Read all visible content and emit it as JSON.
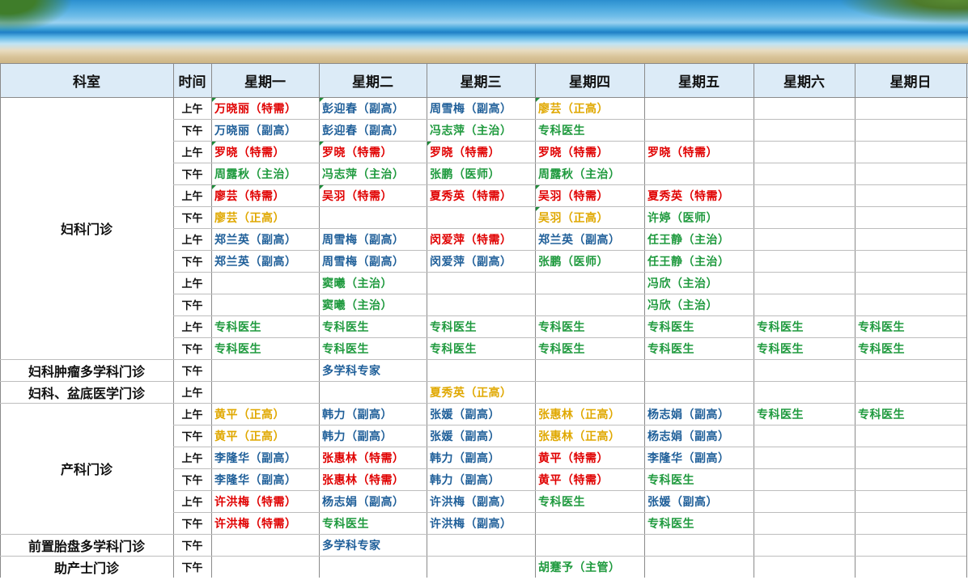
{
  "colors": {
    "red": "#e00000",
    "blue": "#1f5f99",
    "green": "#1f9a3e",
    "gold": "#e0a800",
    "header_bg": "#dcebf7"
  },
  "header": [
    "科室",
    "时间",
    "星期一",
    "星期二",
    "星期三",
    "星期四",
    "星期五",
    "星期六",
    "星期日"
  ],
  "departments": [
    {
      "name": "妇科门诊",
      "rows": [
        {
          "time": "上午",
          "cells": [
            [
              "万晓丽（特需）",
              "red"
            ],
            [
              "彭迎春（副高）",
              "blue"
            ],
            [
              "周雪梅（副高）",
              "blue"
            ],
            [
              "廖芸（正高）",
              "gold"
            ],
            null,
            null,
            null
          ]
        },
        {
          "time": "下午",
          "cells": [
            [
              "万晓丽（副高）",
              "blue"
            ],
            [
              "彭迎春（副高）",
              "blue"
            ],
            [
              "冯志萍（主治）",
              "green"
            ],
            [
              "专科医生",
              "green"
            ],
            null,
            null,
            null
          ]
        },
        {
          "time": "上午",
          "cells": [
            [
              "罗晓（特需）",
              "red"
            ],
            [
              "罗晓（特需）",
              "red"
            ],
            [
              "罗晓（特需）",
              "red"
            ],
            [
              "罗晓（特需）",
              "red"
            ],
            [
              "罗晓（特需）",
              "red"
            ],
            null,
            null
          ]
        },
        {
          "time": "下午",
          "cells": [
            [
              "周露秋（主治）",
              "green"
            ],
            [
              "冯志萍（主治）",
              "green"
            ],
            [
              "张鹏（医师）",
              "green"
            ],
            [
              "周露秋（主治）",
              "green"
            ],
            null,
            null,
            null
          ]
        },
        {
          "time": "上午",
          "cells": [
            [
              "廖芸（特需）",
              "red"
            ],
            [
              "吴羽（特需）",
              "red"
            ],
            [
              "夏秀英（特需）",
              "red"
            ],
            [
              "吴羽（特需）",
              "red"
            ],
            [
              "夏秀英（特需）",
              "red"
            ],
            null,
            null
          ]
        },
        {
          "time": "下午",
          "cells": [
            [
              "廖芸（正高）",
              "gold"
            ],
            null,
            null,
            [
              "吴羽（正高）",
              "gold"
            ],
            [
              "许婷（医师）",
              "green"
            ],
            null,
            null
          ]
        },
        {
          "time": "上午",
          "cells": [
            [
              "郑兰英（副高）",
              "blue"
            ],
            [
              "周雪梅（副高）",
              "blue"
            ],
            [
              "闵爱萍（特需）",
              "red"
            ],
            [
              "郑兰英（副高）",
              "blue"
            ],
            [
              "任王静（主治）",
              "green"
            ],
            null,
            null
          ]
        },
        {
          "time": "下午",
          "cells": [
            [
              "郑兰英（副高）",
              "blue"
            ],
            [
              "周雪梅（副高）",
              "blue"
            ],
            [
              "闵爱萍（副高）",
              "blue"
            ],
            [
              "张鹏（医师）",
              "green"
            ],
            [
              "任王静（主治）",
              "green"
            ],
            null,
            null
          ]
        },
        {
          "time": "上午",
          "cells": [
            null,
            [
              "窦曦（主治）",
              "green"
            ],
            null,
            null,
            [
              "冯欣（主治）",
              "green"
            ],
            null,
            null
          ]
        },
        {
          "time": "下午",
          "cells": [
            null,
            [
              "窦曦（主治）",
              "green"
            ],
            null,
            null,
            [
              "冯欣（主治）",
              "green"
            ],
            null,
            null
          ]
        },
        {
          "time": "上午",
          "cells": [
            [
              "专科医生",
              "green"
            ],
            [
              "专科医生",
              "green"
            ],
            [
              "专科医生",
              "green"
            ],
            [
              "专科医生",
              "green"
            ],
            [
              "专科医生",
              "green"
            ],
            [
              "专科医生",
              "green"
            ],
            [
              "专科医生",
              "green"
            ]
          ]
        },
        {
          "time": "下午",
          "cells": [
            [
              "专科医生",
              "green"
            ],
            [
              "专科医生",
              "green"
            ],
            [
              "专科医生",
              "green"
            ],
            [
              "专科医生",
              "green"
            ],
            [
              "专科医生",
              "green"
            ],
            [
              "专科医生",
              "green"
            ],
            [
              "专科医生",
              "green"
            ]
          ]
        }
      ]
    },
    {
      "name": "妇科肿瘤多学科门诊",
      "rows": [
        {
          "time": "下午",
          "cells": [
            null,
            [
              "多学科专家",
              "blue"
            ],
            null,
            null,
            null,
            null,
            null
          ]
        }
      ]
    },
    {
      "name": "妇科、盆底医学门诊",
      "rows": [
        {
          "time": "上午",
          "cells": [
            null,
            null,
            [
              "夏秀英（正高）",
              "gold"
            ],
            null,
            null,
            null,
            null
          ]
        }
      ]
    },
    {
      "name": "产科门诊",
      "rows": [
        {
          "time": "上午",
          "cells": [
            [
              "黄平（正高）",
              "gold"
            ],
            [
              "韩力（副高）",
              "blue"
            ],
            [
              "张媛（副高）",
              "blue"
            ],
            [
              "张惠林（正高）",
              "gold"
            ],
            [
              "杨志娟（副高）",
              "blue"
            ],
            [
              "专科医生",
              "green"
            ],
            [
              "专科医生",
              "green"
            ]
          ]
        },
        {
          "time": "下午",
          "cells": [
            [
              "黄平（正高）",
              "gold"
            ],
            [
              "韩力（副高）",
              "blue"
            ],
            [
              "张媛（副高）",
              "blue"
            ],
            [
              "张惠林（正高）",
              "gold"
            ],
            [
              "杨志娟（副高）",
              "blue"
            ],
            null,
            null
          ]
        },
        {
          "time": "上午",
          "cells": [
            [
              "李隆华（副高）",
              "blue"
            ],
            [
              "张惠林（特需）",
              "red"
            ],
            [
              "韩力（副高）",
              "blue"
            ],
            [
              "黄平（特需）",
              "red"
            ],
            [
              "李隆华（副高）",
              "blue"
            ],
            null,
            null
          ]
        },
        {
          "time": "下午",
          "cells": [
            [
              "李隆华（副高）",
              "blue"
            ],
            [
              "张惠林（特需）",
              "red"
            ],
            [
              "韩力（副高）",
              "blue"
            ],
            [
              "黄平（特需）",
              "red"
            ],
            [
              "专科医生",
              "green"
            ],
            null,
            null
          ]
        },
        {
          "time": "上午",
          "cells": [
            [
              "许洪梅（特需）",
              "red"
            ],
            [
              "杨志娟（副高）",
              "blue"
            ],
            [
              "许洪梅（副高）",
              "blue"
            ],
            [
              "专科医生",
              "green"
            ],
            [
              "张媛（副高）",
              "blue"
            ],
            null,
            null
          ]
        },
        {
          "time": "下午",
          "cells": [
            [
              "许洪梅（特需）",
              "red"
            ],
            [
              "专科医生",
              "green"
            ],
            [
              "许洪梅（副高）",
              "blue"
            ],
            null,
            [
              "专科医生",
              "green"
            ],
            null,
            null
          ]
        }
      ]
    },
    {
      "name": "前置胎盘多学科门诊",
      "rows": [
        {
          "time": "下午",
          "cells": [
            null,
            [
              "多学科专家",
              "blue"
            ],
            null,
            null,
            null,
            null,
            null
          ]
        }
      ]
    },
    {
      "name": "助产士门诊",
      "rows": [
        {
          "time": "下午",
          "cells": [
            null,
            null,
            null,
            [
              "胡蹇予（主管）",
              "green"
            ],
            null,
            null,
            null
          ]
        }
      ]
    }
  ]
}
